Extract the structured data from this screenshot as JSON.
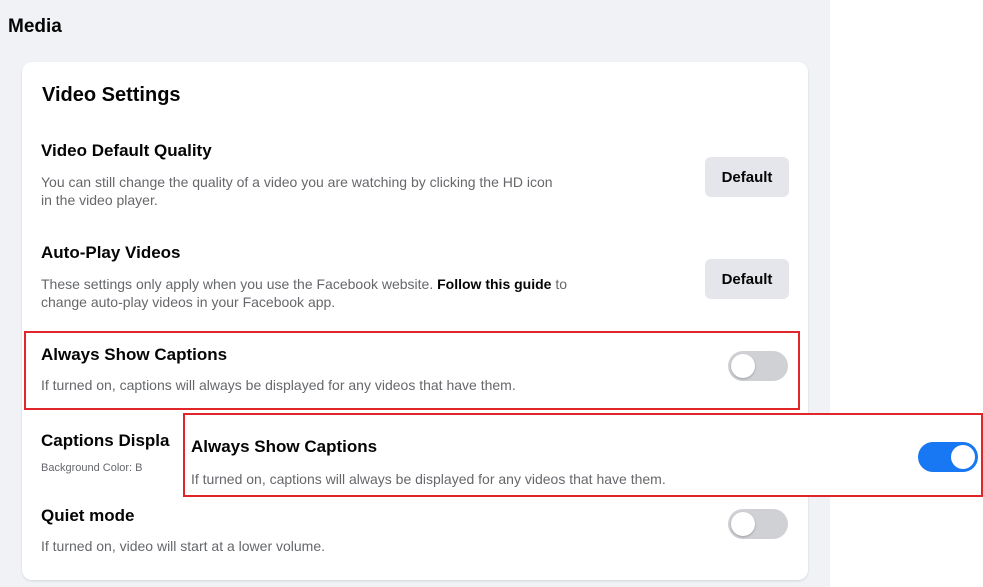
{
  "section": {
    "title": "Media"
  },
  "card": {
    "title": "Video Settings"
  },
  "settings": {
    "quality": {
      "title": "Video Default Quality",
      "desc_line1": "You can still change the quality of a video you are watching by clicking the HD icon",
      "desc_line2": "in the video player.",
      "button_label": "Default"
    },
    "autoplay": {
      "title": "Auto-Play Videos",
      "desc_line1_pre": "These settings only apply when you use the Facebook website. ",
      "desc_link": "Follow this guide",
      "desc_line1_post": " to",
      "desc_line2": "change auto-play videos in your Facebook app.",
      "button_label": "Default"
    },
    "captions": {
      "title": "Always Show Captions",
      "desc": "If turned on, captions will always be displayed for any videos that have them.",
      "toggle_on": false
    },
    "captions_display": {
      "title": "Captions Displa",
      "desc": "Background Color: B"
    },
    "quiet": {
      "title": "Quiet mode",
      "desc": "If turned on, video will start at a lower volume.",
      "toggle_on": false
    }
  },
  "overlay": {
    "title": "Always Show Captions",
    "desc": "If turned on, captions will always be displayed for any videos that have them.",
    "toggle_on": true
  },
  "colors": {
    "accent": "#1877f2",
    "highlight": "#e0262a",
    "toggle_off": "#cfd1d5",
    "panel_bg": "#f0f2f5"
  }
}
